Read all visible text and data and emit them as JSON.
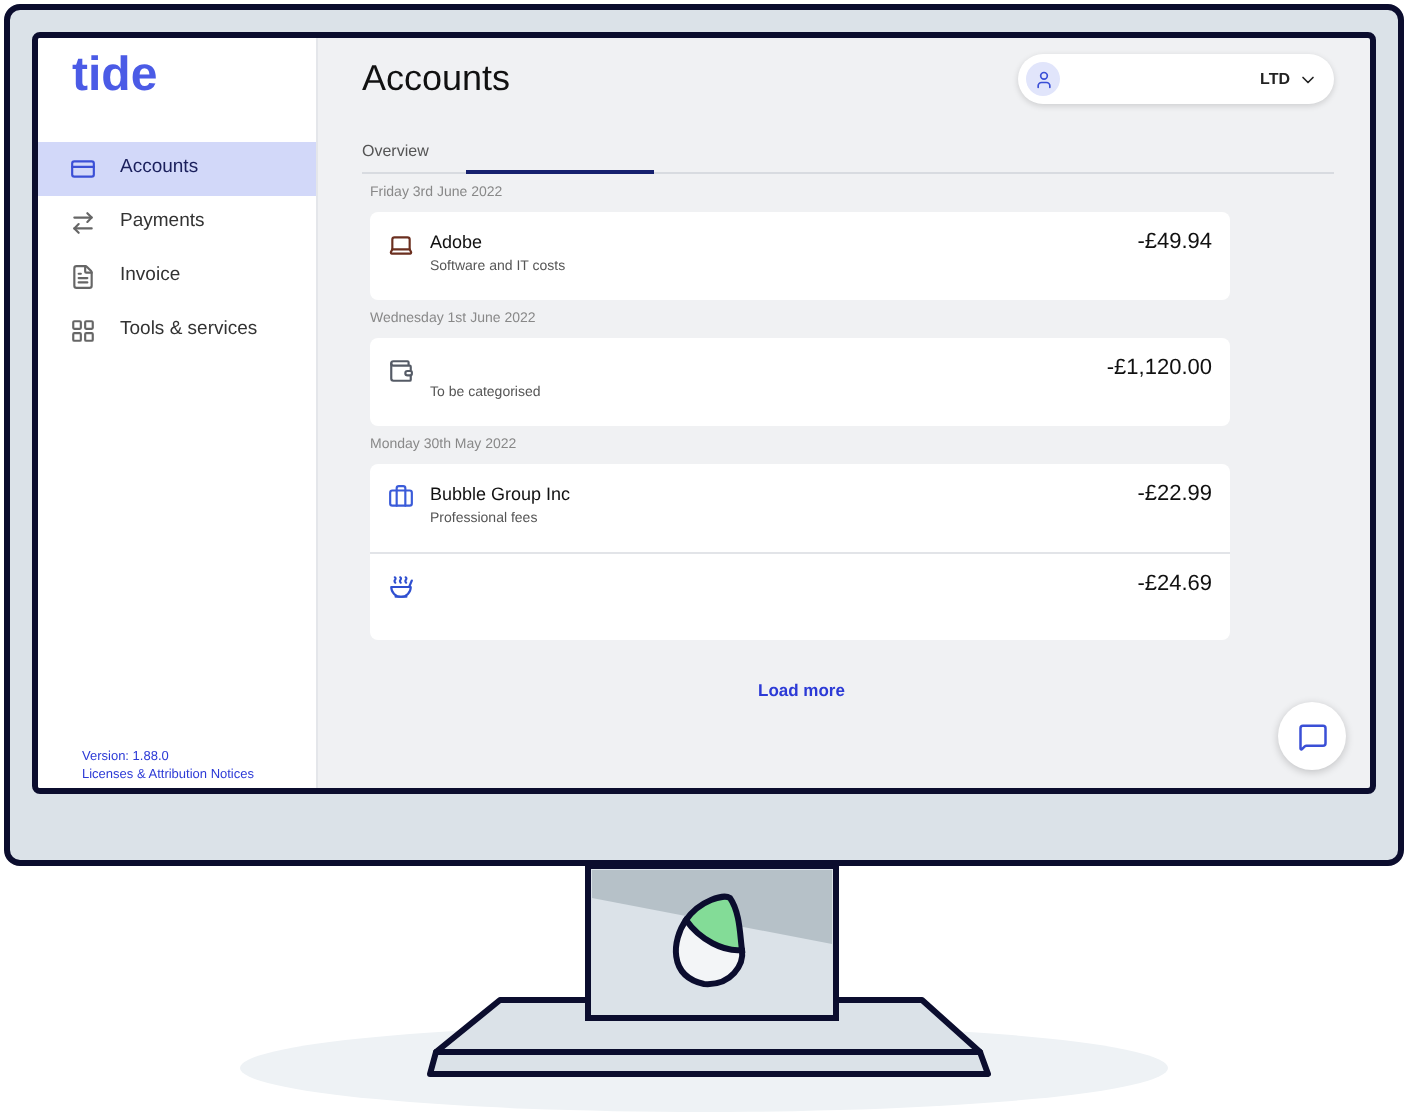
{
  "logo": "tide",
  "sidebar": {
    "items": [
      {
        "label": "Accounts",
        "kind": "card",
        "selected": true
      },
      {
        "label": "Payments",
        "kind": "arrows",
        "selected": false
      },
      {
        "label": "Invoice",
        "kind": "file",
        "selected": false
      },
      {
        "label": "Tools & services",
        "kind": "grid",
        "selected": false
      }
    ],
    "version": "Version: 1.88.0",
    "licenses_link": "Licenses & Attribution Notices"
  },
  "header": {
    "title": "Accounts",
    "account_selector": {
      "label": "LTD"
    }
  },
  "tabs": [
    {
      "label": "Overview"
    }
  ],
  "groups": [
    {
      "date": "Friday 3rd June 2022",
      "transactions": [
        {
          "kind": "laptop",
          "name": "Adobe",
          "category": "Software and IT costs",
          "amount": "-£49.94"
        }
      ]
    },
    {
      "date": "Wednesday 1st June 2022",
      "transactions": [
        {
          "kind": "wallet",
          "category": "To be categorised",
          "amount": "-£1,120.00"
        }
      ]
    },
    {
      "date": "Monday 30th May 2022",
      "transactions": [
        {
          "kind": "briefcase",
          "name": "Bubble Group Inc",
          "category": "Professional fees",
          "amount": "-£22.99"
        },
        {
          "kind": "bowl",
          "amount": "-£24.69"
        }
      ]
    }
  ],
  "load_more": "Load more"
}
